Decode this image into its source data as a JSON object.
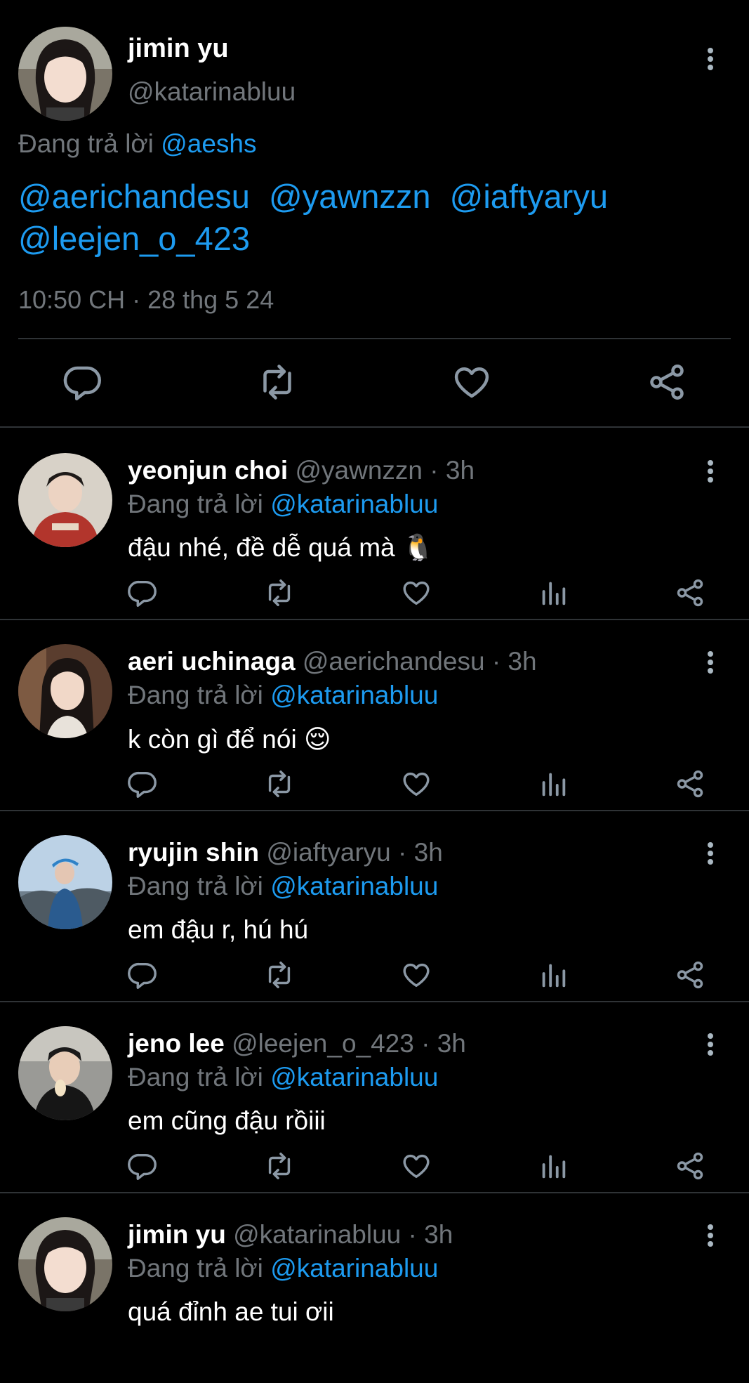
{
  "main_tweet": {
    "name": "jimin yu",
    "handle": "@katarinabluu",
    "reply_prefix": "Đang trả lời",
    "reply_to": "@aeshs",
    "mentions": [
      "@aerichandesu",
      "@yawnzzn",
      "@iaftyaryu",
      "@leejen_o_423"
    ],
    "timestamp": "10:50 CH · 28 thg 5 24",
    "actions": [
      "reply-icon",
      "retweet-icon",
      "like-icon",
      "share-icon"
    ]
  },
  "replies": [
    {
      "name": "yeonjun choi",
      "handle": "@yawnzzn",
      "time": "· 3h",
      "reply_prefix": "Đang trả lời",
      "reply_to": "@katarinabluu",
      "text": "đậu nhé, đề dễ quá mà 🐧"
    },
    {
      "name": "aeri uchinaga",
      "handle": "@aerichandesu",
      "time": "· 3h",
      "reply_prefix": "Đang trả lời",
      "reply_to": "@katarinabluu",
      "text": "k còn gì để nói 😌"
    },
    {
      "name": "ryujin shin",
      "handle": "@iaftyaryu",
      "time": "· 3h",
      "reply_prefix": "Đang trả lời",
      "reply_to": "@katarinabluu",
      "text": "em đậu r, hú hú"
    },
    {
      "name": "jeno lee",
      "handle": "@leejen_o_423",
      "time": "· 3h",
      "reply_prefix": "Đang trả lời",
      "reply_to": "@katarinabluu",
      "text": "em cũng đậu rồiii"
    },
    {
      "name": "jimin yu",
      "handle": "@katarinabluu",
      "time": "· 3h",
      "reply_prefix": "Đang trả lời",
      "reply_to": "@katarinabluu",
      "text": "quá đỉnh ae tui ơii"
    }
  ],
  "colors": {
    "background": "#000000",
    "link": "#1d9bf0",
    "muted": "#71767b",
    "text": "#ffffff",
    "divider": "#2f3336"
  }
}
